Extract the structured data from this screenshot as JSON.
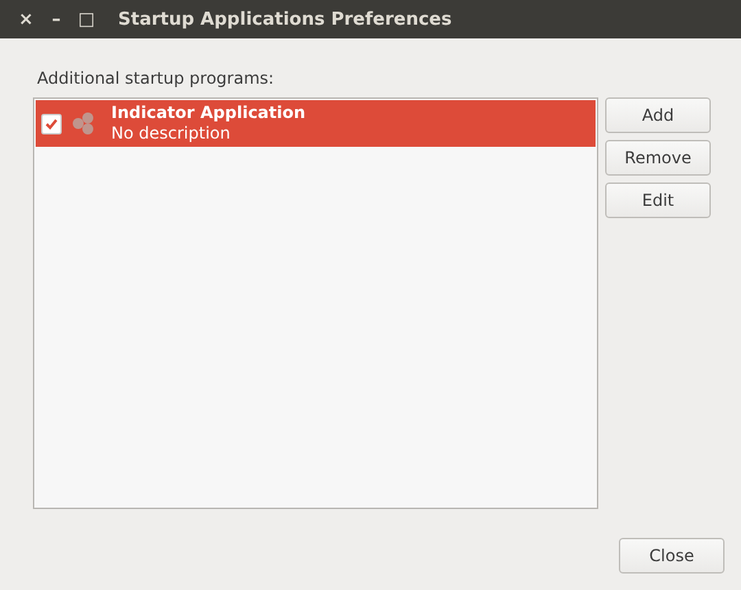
{
  "window": {
    "title": "Startup Applications Preferences",
    "controls": [
      "×",
      "–",
      "□"
    ]
  },
  "list_label": "Additional startup programs:",
  "programs": [
    {
      "name": "Indicator Application",
      "description": "No description",
      "checked": true,
      "selected": true
    }
  ],
  "side_buttons": [
    "Add",
    "Remove",
    "Edit"
  ],
  "close_button": "Close"
}
